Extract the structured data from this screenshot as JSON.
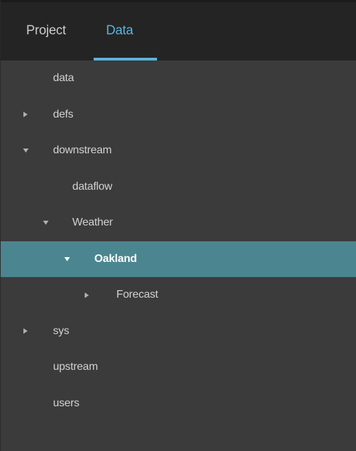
{
  "tabs": {
    "project": "Project",
    "data": "Data"
  },
  "tree": {
    "items": [
      {
        "label": "data",
        "caret": "none"
      },
      {
        "label": "defs",
        "caret": "collapsed"
      },
      {
        "label": "downstream",
        "caret": "expanded"
      },
      {
        "label": "dataflow",
        "caret": "none"
      },
      {
        "label": "Weather",
        "caret": "expanded"
      },
      {
        "label": "Oakland",
        "caret": "expanded",
        "selected": true
      },
      {
        "label": "Forecast",
        "caret": "collapsed"
      },
      {
        "label": "sys",
        "caret": "collapsed"
      },
      {
        "label": "upstream",
        "caret": "none"
      },
      {
        "label": "users",
        "caret": "none"
      }
    ]
  },
  "colors": {
    "accent": "#5ab4dc",
    "selected_row": "#4b8690",
    "tab_bar": "#242424",
    "panel": "#3b3b3b"
  }
}
